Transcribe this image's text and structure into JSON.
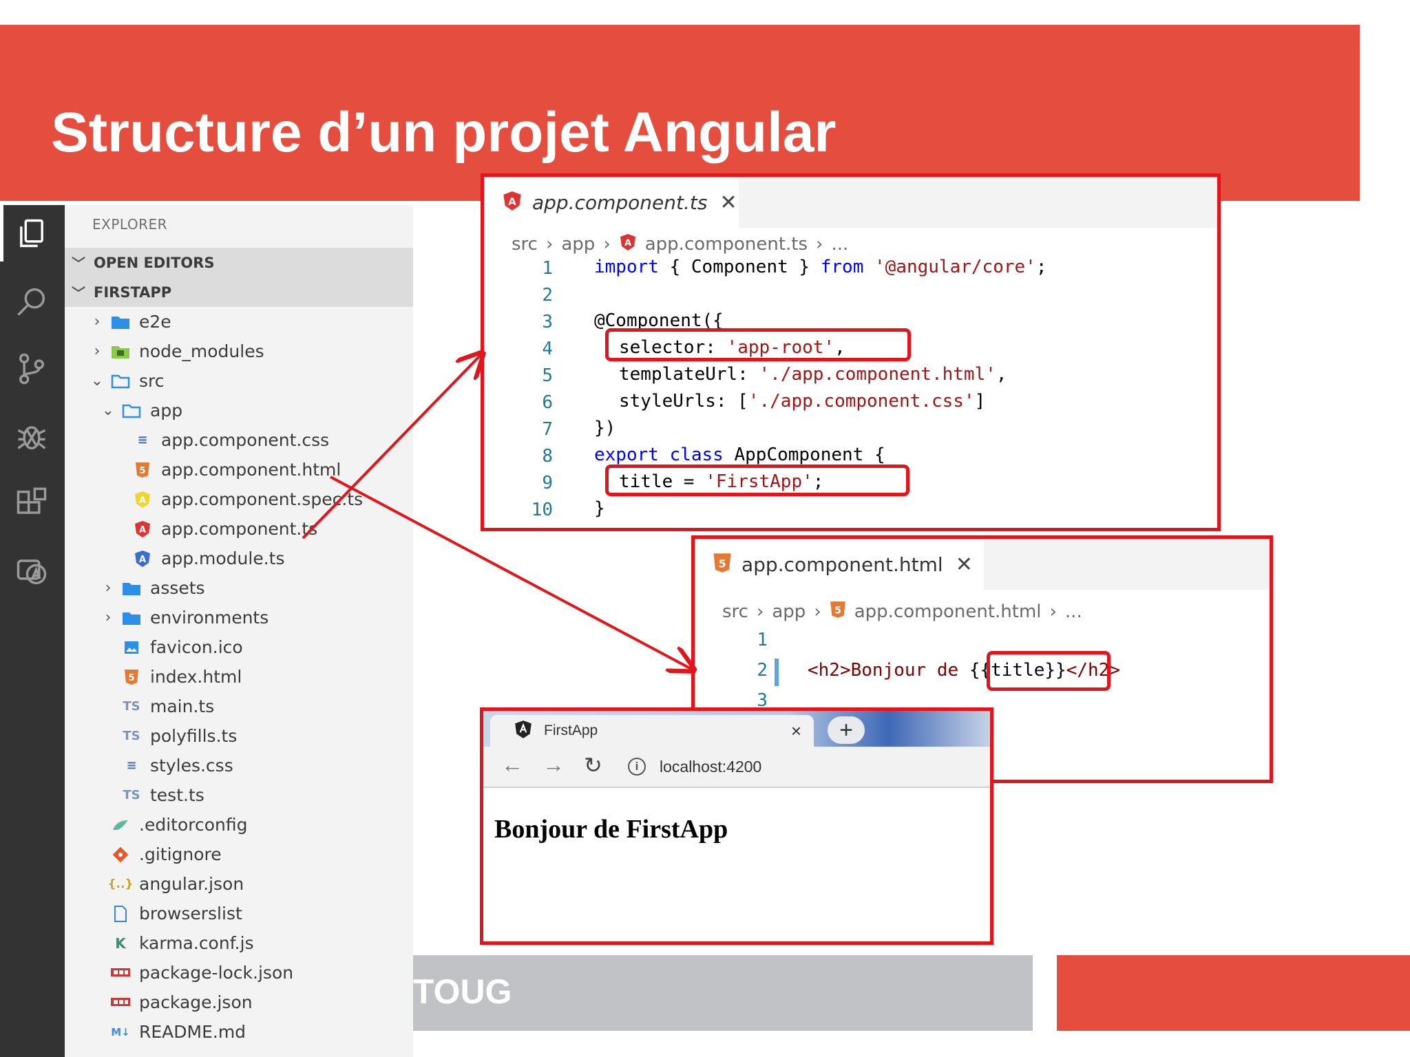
{
  "slide": {
    "title": "Structure d’un projet Angular",
    "footer_text": "TOUG"
  },
  "colors": {
    "accent_red": "#e54d3f",
    "outline_red": "#e0161c",
    "footer_grey": "#c0c2c6"
  },
  "activity_bar": {
    "icons": [
      "explorer-icon",
      "search-icon",
      "source-control-icon",
      "debug-icon",
      "extensions-icon",
      "angular-extension-icon"
    ]
  },
  "explorer": {
    "title": "EXPLORER",
    "open_editors_label": "OPEN EDITORS",
    "project_label": "FIRSTAPP",
    "items": [
      {
        "label": "e2e",
        "icon": "folder-icon"
      },
      {
        "label": "node_modules",
        "icon": "node-folder-icon"
      },
      {
        "label": "src",
        "icon": "open-folder-icon"
      },
      {
        "label": "app",
        "icon": "open-folder-icon"
      },
      {
        "label": "app.component.css",
        "icon": "css-file-icon"
      },
      {
        "label": "app.component.html",
        "icon": "html-file-icon"
      },
      {
        "label": "app.component.spec.ts",
        "icon": "spec-file-icon"
      },
      {
        "label": "app.component.ts",
        "icon": "angular-file-icon"
      },
      {
        "label": "app.module.ts",
        "icon": "angular-module-icon"
      },
      {
        "label": "assets",
        "icon": "folder-icon"
      },
      {
        "label": "environments",
        "icon": "folder-icon"
      },
      {
        "label": "favicon.ico",
        "icon": "image-file-icon"
      },
      {
        "label": "index.html",
        "icon": "html-file-icon"
      },
      {
        "label": "main.ts",
        "icon": "ts-file-icon"
      },
      {
        "label": "polyfills.ts",
        "icon": "ts-file-icon"
      },
      {
        "label": "styles.css",
        "icon": "css-file-icon"
      },
      {
        "label": "test.ts",
        "icon": "ts-file-icon"
      },
      {
        "label": ".editorconfig",
        "icon": "editorconfig-icon"
      },
      {
        "label": ".gitignore",
        "icon": "git-icon"
      },
      {
        "label": "angular.json",
        "icon": "json-file-icon"
      },
      {
        "label": "browserslist",
        "icon": "file-icon"
      },
      {
        "label": "karma.conf.js",
        "icon": "karma-icon"
      },
      {
        "label": "package-lock.json",
        "icon": "npm-icon"
      },
      {
        "label": "package.json",
        "icon": "npm-icon"
      },
      {
        "label": "README.md",
        "icon": "markdown-icon"
      }
    ]
  },
  "ts_editor": {
    "tab_label": "app.component.ts",
    "close_glyph": "✕",
    "breadcrumbs": [
      "src",
      "app",
      "app.component.ts",
      "..."
    ],
    "line_numbers": [
      "1",
      "2",
      "3",
      "4",
      "5",
      "6",
      "7",
      "8",
      "9",
      "10"
    ],
    "lines": {
      "l1_import": "import",
      "l1_mid": " { Component } ",
      "l1_from": "from",
      "l1_module": "'@angular/core'",
      "l1_end": ";",
      "l3": "@Component({",
      "l4_key": "selector: ",
      "l4_val": "'app-root'",
      "l4_end": ",",
      "l5_key": "templateUrl: ",
      "l5_val": "'./app.component.html'",
      "l5_end": ",",
      "l6_key": "styleUrls: [",
      "l6_val": "'./app.component.css'",
      "l6_end": "]",
      "l7": "})",
      "l8_kw": "export class",
      "l8_name": " AppComponent {",
      "l9_key": "title = ",
      "l9_val": "'FirstApp'",
      "l9_end": ";",
      "l10": "}"
    }
  },
  "html_editor": {
    "tab_label": "app.component.html",
    "close_glyph": "✕",
    "breadcrumbs": [
      "src",
      "app",
      "app.component.html",
      "..."
    ],
    "line_numbers": [
      "1",
      "2",
      "3"
    ],
    "line2_start": "<h2>Bonjour de ",
    "line2_binding": "{{title}}",
    "line2_end": "</h2>"
  },
  "browser": {
    "tab_title": "FirstApp",
    "close_glyph": "×",
    "newtab_glyph": "+",
    "url": "localhost:4200",
    "page_heading": "Bonjour de FirstApp"
  }
}
